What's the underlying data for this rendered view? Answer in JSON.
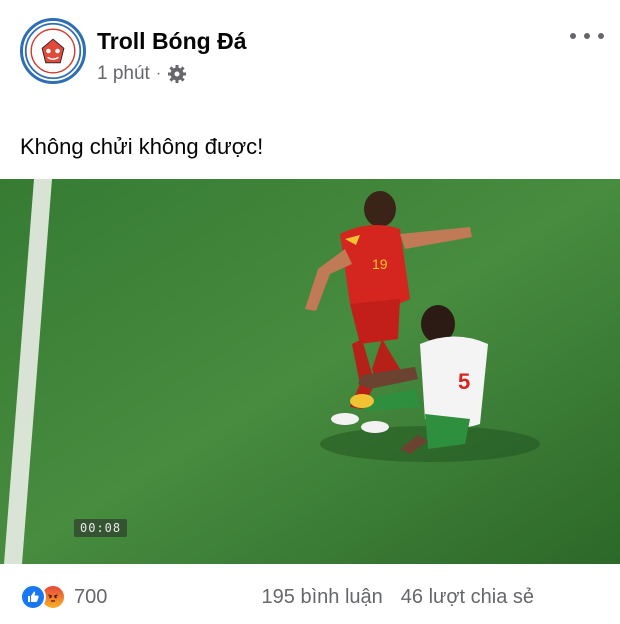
{
  "post": {
    "page_name": "Troll Bóng Đá",
    "time": "1 phút",
    "separator": "·",
    "privacy_icon": "gear-icon",
    "more_icon": "more-options-icon",
    "avatar_text": "TROLL BÓNG ĐÁ",
    "caption": "Không chửi không được!"
  },
  "video": {
    "timestamp": "00:08",
    "player_left_number": "19",
    "player_right_number": "5",
    "pitch_color": "#3f8a3a"
  },
  "footer": {
    "reaction_icons": [
      "like-icon",
      "angry-icon"
    ],
    "reaction_count": "700",
    "comments": "195 bình luận",
    "shares": "46 lượt chia sẻ"
  },
  "colors": {
    "accent": "#1877f2",
    "secondary_text": "#65676b",
    "avatar_ring": "#2f6db5"
  }
}
